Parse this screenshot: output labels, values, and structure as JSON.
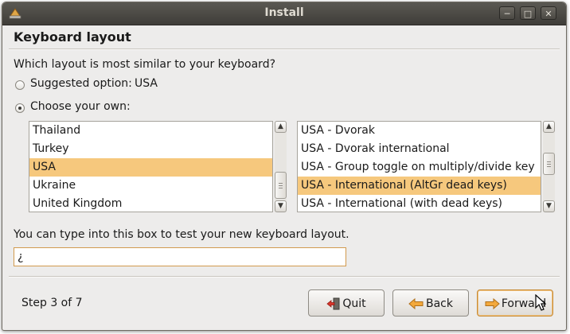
{
  "window": {
    "title": "Install"
  },
  "page": {
    "heading": "Keyboard layout"
  },
  "question": "Which layout is most similar to your keyboard?",
  "options": {
    "suggested_label": "Suggested option:",
    "suggested_value": "USA",
    "choose_label": "Choose your own:",
    "selected": "choose"
  },
  "layouts": {
    "items": [
      "Thailand",
      "Turkey",
      "USA",
      "Ukraine",
      "United Kingdom"
    ],
    "selected_index": 2
  },
  "variants": {
    "items": [
      "USA - Dvorak",
      "USA - Dvorak international",
      "USA - Group toggle on multiply/divide key",
      "USA - International (AltGr dead keys)",
      "USA - International (with dead keys)"
    ],
    "selected_index": 3
  },
  "test": {
    "label": "You can type into this box to test your new keyboard layout.",
    "value": "¿"
  },
  "footer": {
    "step": "Step 3 of 7",
    "quit_label": "Quit",
    "back_label": "Back",
    "forward_label": "Forward"
  },
  "colors": {
    "selection": "#f6c87d",
    "titlebar": "#4a4843",
    "focus_border": "#d29a4e"
  }
}
